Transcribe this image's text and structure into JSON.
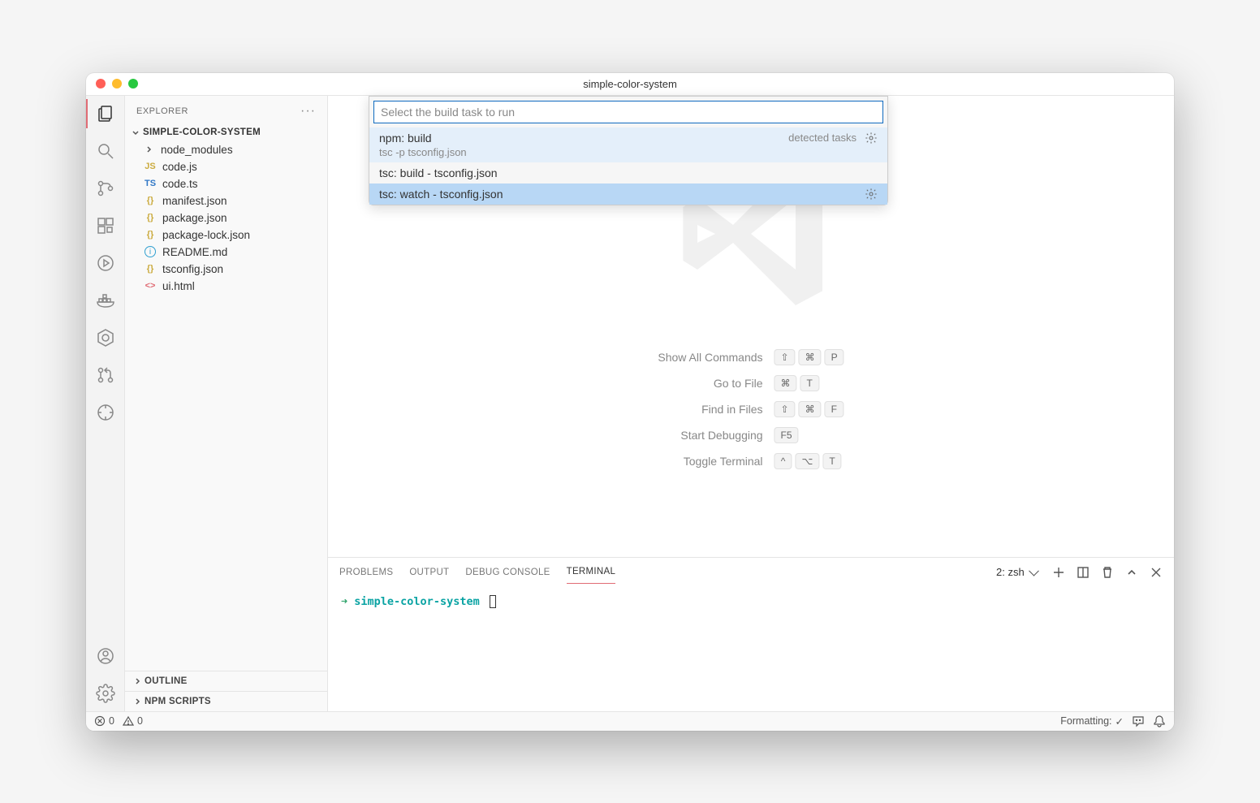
{
  "window": {
    "title": "simple-color-system"
  },
  "sidebar": {
    "title": "EXPLORER",
    "folder": "SIMPLE-COLOR-SYSTEM",
    "tree": {
      "node_modules": "node_modules",
      "code_js": "code.js",
      "code_ts": "code.ts",
      "manifest_json": "manifest.json",
      "package_json": "package.json",
      "package_lock_json": "package-lock.json",
      "readme_md": "README.md",
      "tsconfig_json": "tsconfig.json",
      "ui_html": "ui.html"
    },
    "outline": "OUTLINE",
    "npm_scripts": "NPM SCRIPTS"
  },
  "quickpick": {
    "placeholder": "Select the build task to run",
    "detected_label": "detected tasks",
    "items": {
      "i0": {
        "title": "npm: build",
        "desc": "tsc -p tsconfig.json"
      },
      "i1": {
        "title": "tsc: build - tsconfig.json"
      },
      "i2": {
        "title": "tsc: watch - tsconfig.json"
      }
    }
  },
  "shortcuts": {
    "show_all": {
      "label": "Show All Commands",
      "k0": "⇧",
      "k1": "⌘",
      "k2": "P"
    },
    "go_file": {
      "label": "Go to File",
      "k0": "⌘",
      "k1": "T"
    },
    "find": {
      "label": "Find in Files",
      "k0": "⇧",
      "k1": "⌘",
      "k2": "F"
    },
    "debug": {
      "label": "Start Debugging",
      "k0": "F5"
    },
    "terminal": {
      "label": "Toggle Terminal",
      "k0": "^",
      "k1": "⌥",
      "k2": "T"
    }
  },
  "panel": {
    "tabs": {
      "problems": "PROBLEMS",
      "output": "OUTPUT",
      "debug": "DEBUG CONSOLE",
      "terminal": "TERMINAL"
    },
    "terminal_selector": "2: zsh",
    "terminal": {
      "arrow": "➜",
      "cwd": "simple-color-system"
    }
  },
  "statusbar": {
    "err_count": "0",
    "warn_count": "0",
    "formatting": "Formatting:",
    "check": "✓"
  },
  "icons": {
    "js": "JS",
    "ts": "TS",
    "json": "{}",
    "info": "i",
    "html": "<>"
  }
}
